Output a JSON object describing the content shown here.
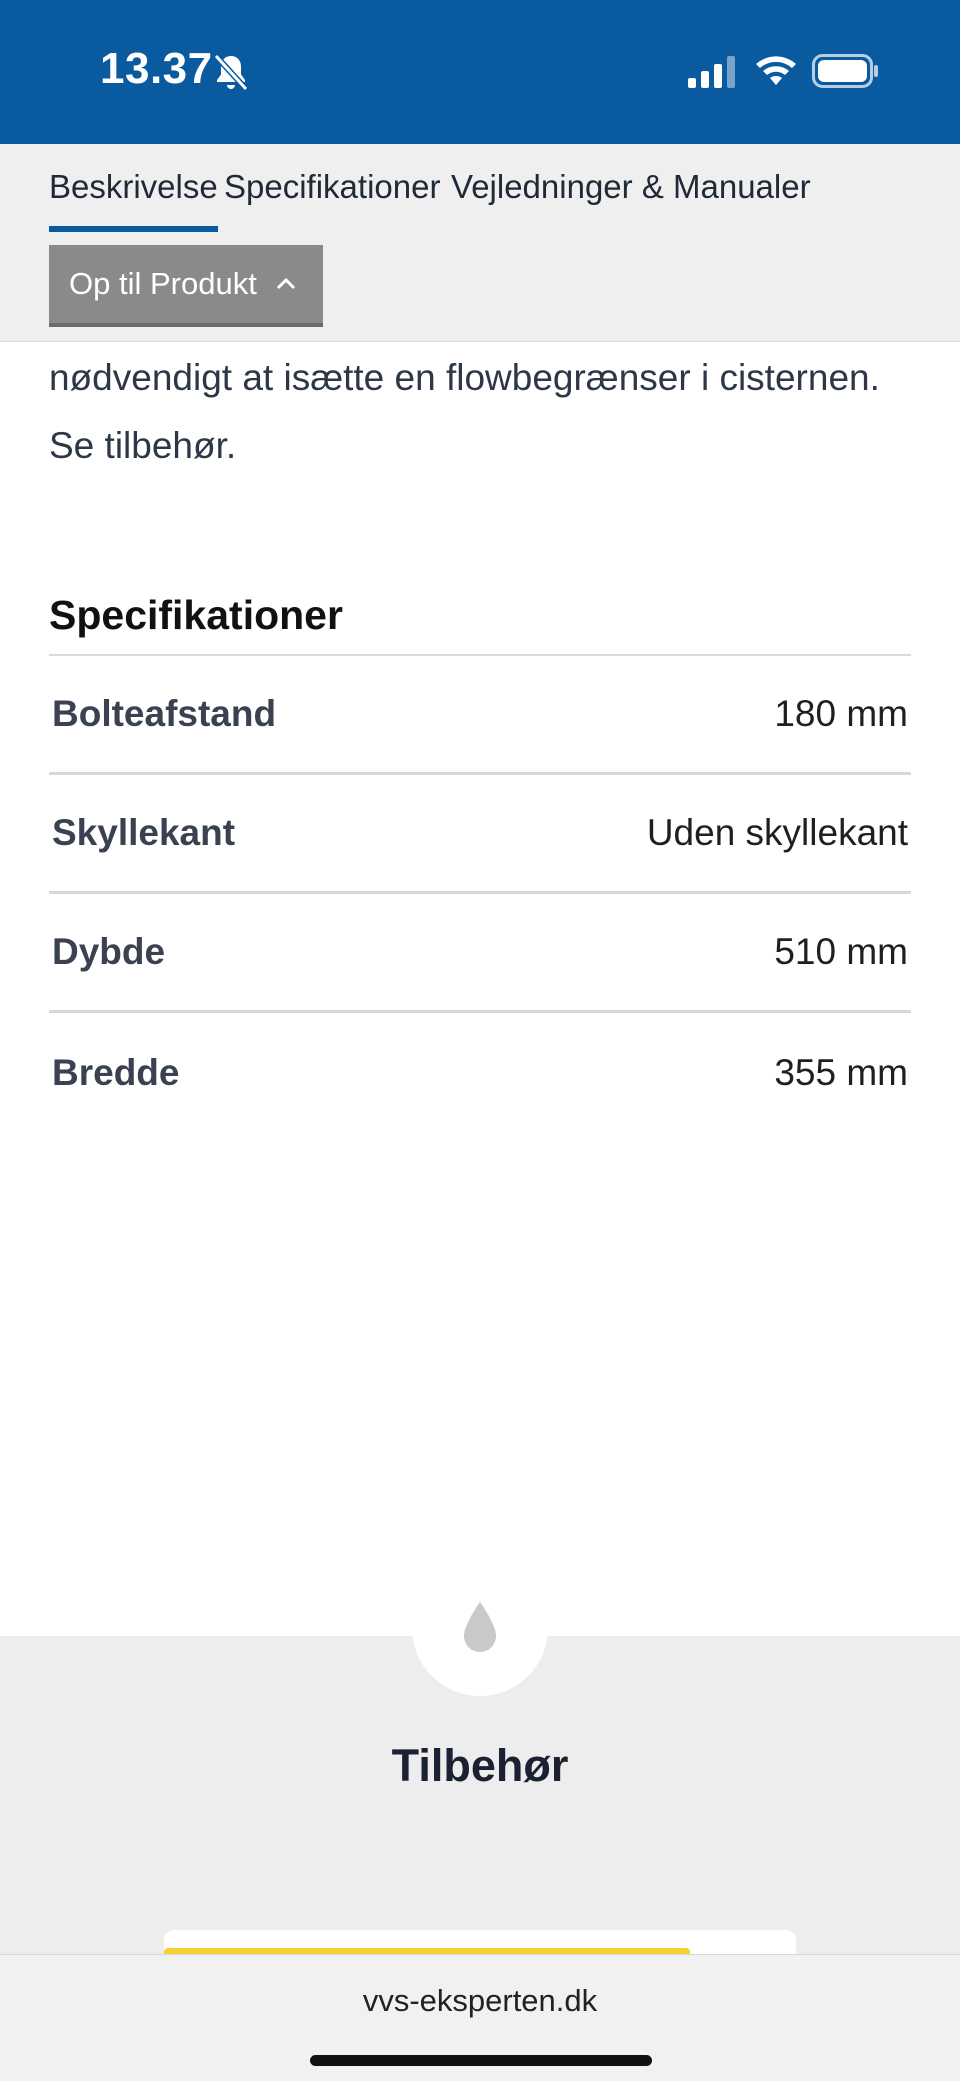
{
  "status_bar": {
    "time": "13.37",
    "icons": [
      "bell-muted-icon",
      "signal-icon",
      "wifi-icon",
      "battery-icon"
    ],
    "background": "#0a5aa0"
  },
  "tabs": [
    {
      "label": "Beskrivelse",
      "active": true
    },
    {
      "label": "Specifikationer",
      "active": false
    },
    {
      "label": "Vejledninger & Manualer",
      "active": false
    }
  ],
  "up_button": {
    "label": "Op til Produkt",
    "icon": "chevron-up-icon"
  },
  "description": {
    "line1": "nødvendigt at isætte en flowbegrænser i cisternen.",
    "line2": "Se tilbehør."
  },
  "specifications": {
    "title": "Specifikationer",
    "rows": [
      {
        "label": "Bolteafstand",
        "value": "180 mm"
      },
      {
        "label": "Skyllekant",
        "value": "Uden skyllekant"
      },
      {
        "label": "Dybde",
        "value": "510 mm"
      },
      {
        "label": "Bredde",
        "value": "355 mm"
      }
    ]
  },
  "accessories": {
    "title": "Tilbehør",
    "icon": "water-drop-icon"
  },
  "browser": {
    "url": "vvs-eksperten.dk"
  },
  "colors": {
    "accent": "#0a5aa0",
    "highlight": "#f5d033"
  }
}
